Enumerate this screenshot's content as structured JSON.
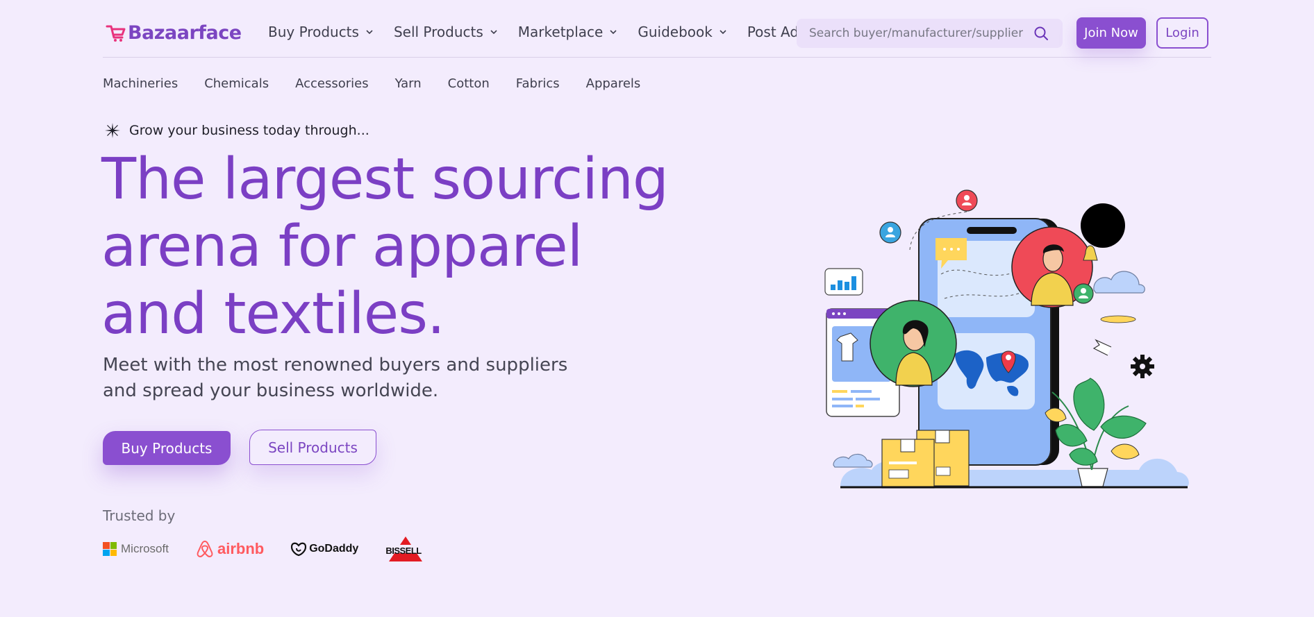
{
  "header": {
    "logo_text": "Bazaarface",
    "nav": [
      {
        "label": "Buy Products"
      },
      {
        "label": "Sell Products"
      },
      {
        "label": "Marketplace"
      },
      {
        "label": "Guidebook"
      },
      {
        "label": "Post Ad"
      }
    ],
    "search": {
      "placeholder": "Search buyer/manufacturer/supplier",
      "icon": "search-icon"
    },
    "join_label": "Join Now",
    "login_label": "Login"
  },
  "categories": [
    "Machineries",
    "Chemicals",
    "Accessories",
    "Yarn",
    "Cotton",
    "Fabrics",
    "Apparels"
  ],
  "hero": {
    "tagline": "Grow your business today through...",
    "headline_lines": [
      "The largest sourcing",
      "arena for apparel",
      "and textiles."
    ],
    "subtitle_lines": [
      "Meet with the most renowned buyers and suppliers",
      "and spread your business worldwide."
    ],
    "buy_label": "Buy Products",
    "sell_label": "Sell Products"
  },
  "trusted": {
    "label": "Trusted by",
    "brands": [
      "Microsoft",
      "airbnb",
      "GoDaddy",
      "BISSELL"
    ]
  },
  "colors": {
    "background": "#f3ecfd",
    "accent": "#8a4fd0",
    "headline": "#7b3fc4",
    "logo_pink": "#e8337d"
  }
}
